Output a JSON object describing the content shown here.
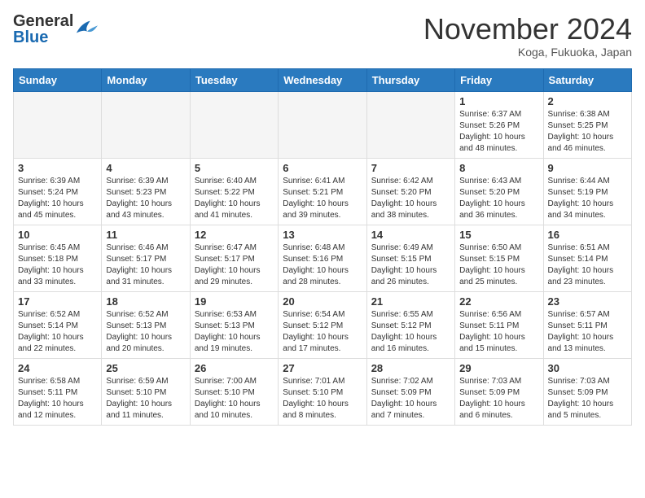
{
  "header": {
    "logo_general": "General",
    "logo_blue": "Blue",
    "month_title": "November 2024",
    "location": "Koga, Fukuoka, Japan"
  },
  "calendar": {
    "days_of_week": [
      "Sunday",
      "Monday",
      "Tuesday",
      "Wednesday",
      "Thursday",
      "Friday",
      "Saturday"
    ],
    "weeks": [
      [
        {
          "day": "",
          "info": ""
        },
        {
          "day": "",
          "info": ""
        },
        {
          "day": "",
          "info": ""
        },
        {
          "day": "",
          "info": ""
        },
        {
          "day": "",
          "info": ""
        },
        {
          "day": "1",
          "info": "Sunrise: 6:37 AM\nSunset: 5:26 PM\nDaylight: 10 hours\nand 48 minutes."
        },
        {
          "day": "2",
          "info": "Sunrise: 6:38 AM\nSunset: 5:25 PM\nDaylight: 10 hours\nand 46 minutes."
        }
      ],
      [
        {
          "day": "3",
          "info": "Sunrise: 6:39 AM\nSunset: 5:24 PM\nDaylight: 10 hours\nand 45 minutes."
        },
        {
          "day": "4",
          "info": "Sunrise: 6:39 AM\nSunset: 5:23 PM\nDaylight: 10 hours\nand 43 minutes."
        },
        {
          "day": "5",
          "info": "Sunrise: 6:40 AM\nSunset: 5:22 PM\nDaylight: 10 hours\nand 41 minutes."
        },
        {
          "day": "6",
          "info": "Sunrise: 6:41 AM\nSunset: 5:21 PM\nDaylight: 10 hours\nand 39 minutes."
        },
        {
          "day": "7",
          "info": "Sunrise: 6:42 AM\nSunset: 5:20 PM\nDaylight: 10 hours\nand 38 minutes."
        },
        {
          "day": "8",
          "info": "Sunrise: 6:43 AM\nSunset: 5:20 PM\nDaylight: 10 hours\nand 36 minutes."
        },
        {
          "day": "9",
          "info": "Sunrise: 6:44 AM\nSunset: 5:19 PM\nDaylight: 10 hours\nand 34 minutes."
        }
      ],
      [
        {
          "day": "10",
          "info": "Sunrise: 6:45 AM\nSunset: 5:18 PM\nDaylight: 10 hours\nand 33 minutes."
        },
        {
          "day": "11",
          "info": "Sunrise: 6:46 AM\nSunset: 5:17 PM\nDaylight: 10 hours\nand 31 minutes."
        },
        {
          "day": "12",
          "info": "Sunrise: 6:47 AM\nSunset: 5:17 PM\nDaylight: 10 hours\nand 29 minutes."
        },
        {
          "day": "13",
          "info": "Sunrise: 6:48 AM\nSunset: 5:16 PM\nDaylight: 10 hours\nand 28 minutes."
        },
        {
          "day": "14",
          "info": "Sunrise: 6:49 AM\nSunset: 5:15 PM\nDaylight: 10 hours\nand 26 minutes."
        },
        {
          "day": "15",
          "info": "Sunrise: 6:50 AM\nSunset: 5:15 PM\nDaylight: 10 hours\nand 25 minutes."
        },
        {
          "day": "16",
          "info": "Sunrise: 6:51 AM\nSunset: 5:14 PM\nDaylight: 10 hours\nand 23 minutes."
        }
      ],
      [
        {
          "day": "17",
          "info": "Sunrise: 6:52 AM\nSunset: 5:14 PM\nDaylight: 10 hours\nand 22 minutes."
        },
        {
          "day": "18",
          "info": "Sunrise: 6:52 AM\nSunset: 5:13 PM\nDaylight: 10 hours\nand 20 minutes."
        },
        {
          "day": "19",
          "info": "Sunrise: 6:53 AM\nSunset: 5:13 PM\nDaylight: 10 hours\nand 19 minutes."
        },
        {
          "day": "20",
          "info": "Sunrise: 6:54 AM\nSunset: 5:12 PM\nDaylight: 10 hours\nand 17 minutes."
        },
        {
          "day": "21",
          "info": "Sunrise: 6:55 AM\nSunset: 5:12 PM\nDaylight: 10 hours\nand 16 minutes."
        },
        {
          "day": "22",
          "info": "Sunrise: 6:56 AM\nSunset: 5:11 PM\nDaylight: 10 hours\nand 15 minutes."
        },
        {
          "day": "23",
          "info": "Sunrise: 6:57 AM\nSunset: 5:11 PM\nDaylight: 10 hours\nand 13 minutes."
        }
      ],
      [
        {
          "day": "24",
          "info": "Sunrise: 6:58 AM\nSunset: 5:11 PM\nDaylight: 10 hours\nand 12 minutes."
        },
        {
          "day": "25",
          "info": "Sunrise: 6:59 AM\nSunset: 5:10 PM\nDaylight: 10 hours\nand 11 minutes."
        },
        {
          "day": "26",
          "info": "Sunrise: 7:00 AM\nSunset: 5:10 PM\nDaylight: 10 hours\nand 10 minutes."
        },
        {
          "day": "27",
          "info": "Sunrise: 7:01 AM\nSunset: 5:10 PM\nDaylight: 10 hours\nand 8 minutes."
        },
        {
          "day": "28",
          "info": "Sunrise: 7:02 AM\nSunset: 5:09 PM\nDaylight: 10 hours\nand 7 minutes."
        },
        {
          "day": "29",
          "info": "Sunrise: 7:03 AM\nSunset: 5:09 PM\nDaylight: 10 hours\nand 6 minutes."
        },
        {
          "day": "30",
          "info": "Sunrise: 7:03 AM\nSunset: 5:09 PM\nDaylight: 10 hours\nand 5 minutes."
        }
      ]
    ]
  }
}
